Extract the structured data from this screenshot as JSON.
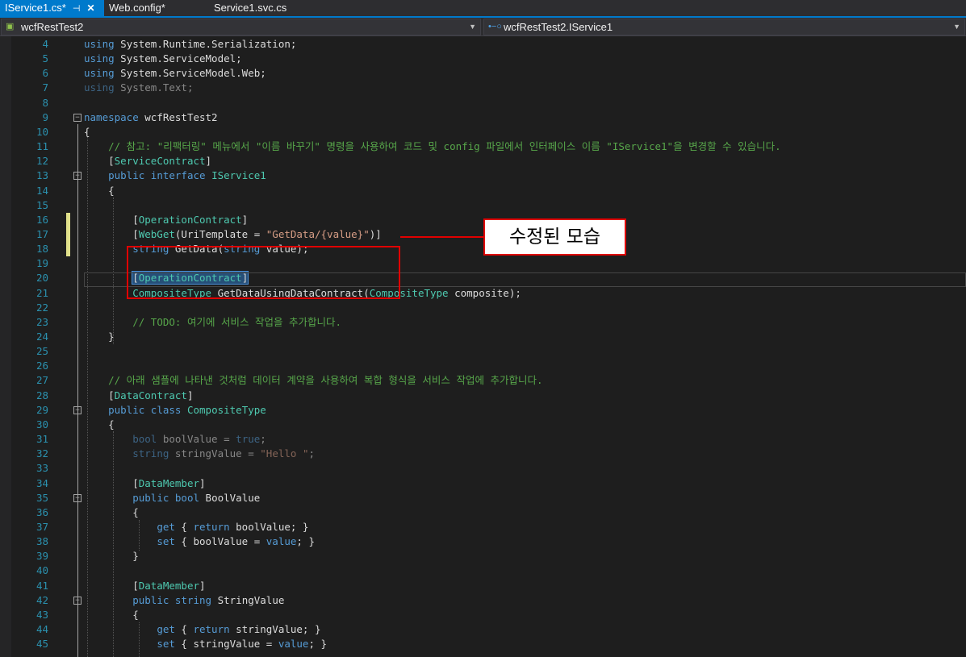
{
  "tabs": [
    {
      "label": "IService1.cs*",
      "active": true
    },
    {
      "label": "Web.config*",
      "active": false
    },
    {
      "label": "Service1.svc.cs",
      "active": false
    }
  ],
  "nav": {
    "project": "wcfRestTest2",
    "member": "wcfRestTest2.IService1"
  },
  "annotation": {
    "label": "수정된 모습"
  },
  "lines": [
    {
      "n": "4",
      "html": "<span class=\"kw\">using</span> System.Runtime.Serialization;"
    },
    {
      "n": "5",
      "html": "<span class=\"kw\">using</span> System.ServiceModel;"
    },
    {
      "n": "6",
      "html": "<span class=\"kw\">using</span> System.ServiceModel.Web;"
    },
    {
      "n": "7",
      "html": "<span class=\"dim\"><span class=\"kw\">using</span> System.Text;</span>"
    },
    {
      "n": "8",
      "html": ""
    },
    {
      "n": "9",
      "html": "<span class=\"kw\">namespace</span> wcfRestTest2",
      "fold": true
    },
    {
      "n": "10",
      "html": "{"
    },
    {
      "n": "11",
      "html": "    <span class=\"cm\">// 참고: \"리팩터링\" 메뉴에서 \"이름 바꾸기\" 명령을 사용하여 코드 및 config 파일에서 인터페이스 이름 \"IService1\"을 변경할 수 있습니다.</span>"
    },
    {
      "n": "12",
      "html": "    [<span class=\"ty\">ServiceContract</span>]"
    },
    {
      "n": "13",
      "html": "    <span class=\"kw\">public</span> <span class=\"kw\">interface</span> <span class=\"ty\">IService1</span>",
      "fold": true
    },
    {
      "n": "14",
      "html": "    {"
    },
    {
      "n": "15",
      "html": ""
    },
    {
      "n": "16",
      "html": "        [<span class=\"ty\">OperationContract</span>]",
      "chg": true
    },
    {
      "n": "17",
      "html": "        [<span class=\"ty\">WebGet</span>(UriTemplate = <span class=\"st\">\"GetData/{value}\"</span>)]",
      "chg": true
    },
    {
      "n": "18",
      "html": "        <span class=\"kw\">string</span> GetData(<span class=\"kw\">string</span> value);",
      "chg": true
    },
    {
      "n": "19",
      "html": ""
    },
    {
      "n": "20",
      "html": "        <span class=\"hl\">[<span class=\"ty\">OperationContract</span>]</span>"
    },
    {
      "n": "21",
      "html": "        <span class=\"ty\">CompositeType</span> GetDataUsingDataContract(<span class=\"ty\">CompositeType</span> composite);"
    },
    {
      "n": "22",
      "html": ""
    },
    {
      "n": "23",
      "html": "        <span class=\"cm\">// TODO: 여기에 서비스 작업을 추가합니다.</span>"
    },
    {
      "n": "24",
      "html": "    }"
    },
    {
      "n": "25",
      "html": ""
    },
    {
      "n": "26",
      "html": ""
    },
    {
      "n": "27",
      "html": "    <span class=\"cm\">// 아래 샘플에 나타낸 것처럼 데이터 계약을 사용하여 복합 형식을 서비스 작업에 추가합니다.</span>"
    },
    {
      "n": "28",
      "html": "    [<span class=\"ty\">DataContract</span>]"
    },
    {
      "n": "29",
      "html": "    <span class=\"kw\">public</span> <span class=\"kw\">class</span> <span class=\"ty\">CompositeType</span>",
      "fold": true
    },
    {
      "n": "30",
      "html": "    {"
    },
    {
      "n": "31",
      "html": "        <span class=\"dim\"><span class=\"kw\">bool</span> boolValue = <span class=\"kw\">true</span>;</span>"
    },
    {
      "n": "32",
      "html": "        <span class=\"dim\"><span class=\"kw\">string</span> stringValue = <span class=\"st\">\"Hello \"</span>;</span>"
    },
    {
      "n": "33",
      "html": ""
    },
    {
      "n": "34",
      "html": "        [<span class=\"ty\">DataMember</span>]"
    },
    {
      "n": "35",
      "html": "        <span class=\"kw\">public</span> <span class=\"kw\">bool</span> BoolValue",
      "fold": true
    },
    {
      "n": "36",
      "html": "        {"
    },
    {
      "n": "37",
      "html": "            <span class=\"kw\">get</span> { <span class=\"kw\">return</span> boolValue; }"
    },
    {
      "n": "38",
      "html": "            <span class=\"kw\">set</span> { boolValue = <span class=\"kw\">value</span>; }"
    },
    {
      "n": "39",
      "html": "        }"
    },
    {
      "n": "40",
      "html": ""
    },
    {
      "n": "41",
      "html": "        [<span class=\"ty\">DataMember</span>]"
    },
    {
      "n": "42",
      "html": "        <span class=\"kw\">public</span> <span class=\"kw\">string</span> StringValue",
      "fold": true
    },
    {
      "n": "43",
      "html": "        {"
    },
    {
      "n": "44",
      "html": "            <span class=\"kw\">get</span> { <span class=\"kw\">return</span> stringValue; }"
    },
    {
      "n": "45",
      "html": "            <span class=\"kw\">set</span> { stringValue = <span class=\"kw\">value</span>; }"
    }
  ]
}
